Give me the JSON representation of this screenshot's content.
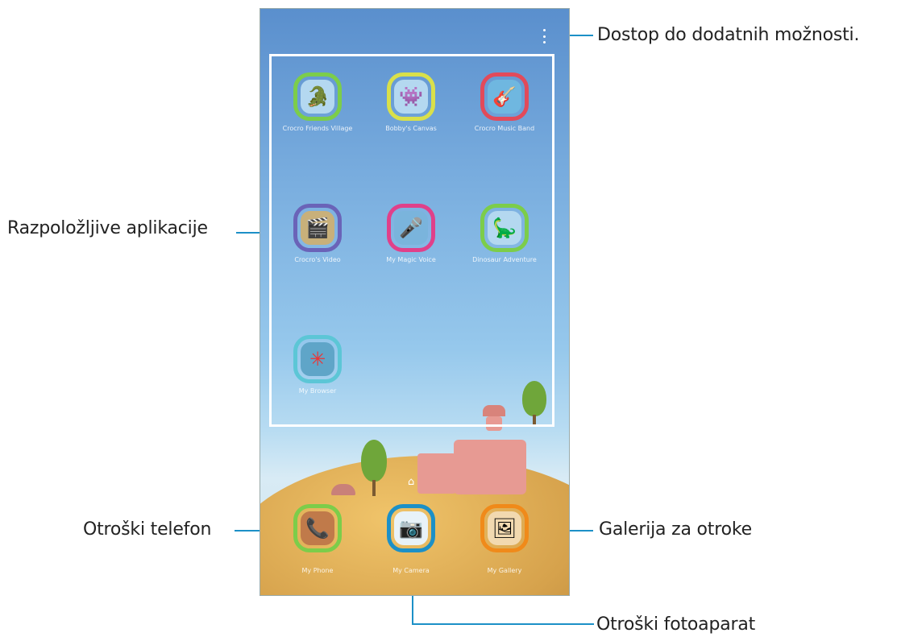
{
  "callouts": {
    "more_options": "Dostop do dodatnih možnosti.",
    "available_apps": "Razpoložljive aplikacije",
    "kids_phone": "Otroški telefon",
    "kids_gallery": "Galerija za otroke",
    "kids_camera": "Otroški fotoaparat"
  },
  "apps": [
    {
      "label": "Crocro Friends Village",
      "icon": "crocodile-house-icon"
    },
    {
      "label": "Bobby's Canvas",
      "icon": "pink-monster-icon"
    },
    {
      "label": "Crocro Music Band",
      "icon": "music-band-icon"
    },
    {
      "label": "Crocro's Video",
      "icon": "video-monster-icon"
    },
    {
      "label": "My Magic Voice",
      "icon": "microphone-icon"
    },
    {
      "label": "Dinosaur Adventure",
      "icon": "dinosaur-icon"
    },
    {
      "label": "My Browser",
      "icon": "browser-wheel-icon"
    }
  ],
  "dock": [
    {
      "label": "My Phone",
      "icon": "phone-icon"
    },
    {
      "label": "My Camera",
      "icon": "camera-icon"
    },
    {
      "label": "My Gallery",
      "icon": "gallery-icon"
    }
  ],
  "colors": {
    "callout_line": "#1c90c7",
    "sky_top": "#5a8fcd",
    "ground": "#d6a24c"
  }
}
